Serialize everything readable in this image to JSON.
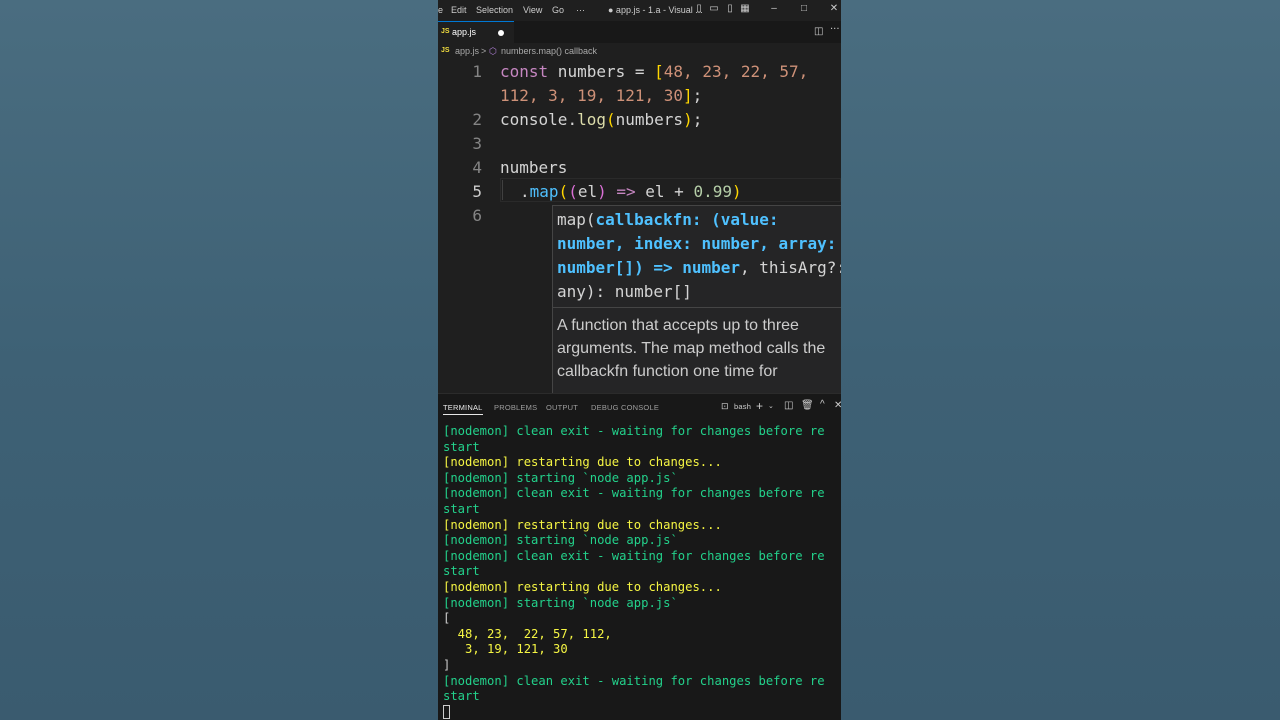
{
  "titlebar": {
    "menu": [
      "e",
      "Edit",
      "Selection",
      "View",
      "Go",
      "···"
    ],
    "title": "● app.js - 1.a - Visual ..."
  },
  "tab": {
    "icon": "JS",
    "name": "app.js",
    "dirty_icon": "dot-icon"
  },
  "breadcrumb": {
    "file": "app.js",
    "separator": ">",
    "symbol": "numbers.map() callback"
  },
  "editor": {
    "line_numbers": [
      "1",
      "2",
      "3",
      "4",
      "5",
      "6"
    ],
    "line1a": {
      "kw": "const",
      "name": " numbers ",
      "eq": "= ",
      "open": "[",
      "nums": "48, 23, 22, 57,",
      "nums_color": "#ce9178"
    },
    "line1b": {
      "nums": "112, 3, 19, 121, 30",
      "close": "]",
      "semi": ";"
    },
    "line2": {
      "obj": "console",
      "dot": ".",
      "fn": "log",
      "open": "(",
      "arg": "numbers",
      "close": ")",
      "semi": ";"
    },
    "line4": {
      "text": "numbers"
    },
    "line5": {
      "dot": ".",
      "fn": "map",
      "open1": "(",
      "open2": "(",
      "param": "el",
      "close2": ")",
      "arrow": " => ",
      "expr": "el + ",
      "num": "0.99",
      "close1": ")"
    }
  },
  "hover": {
    "sig_line1_a": "map(",
    "sig_line1_b": "callbackfn: (value:",
    "sig_line2": "number, index: number, array:",
    "sig_line3_a": "number[]) => number",
    "sig_line3_b": ", thisArg?:",
    "sig_line4": "any): number[]",
    "doc": "A function that accepts up to three arguments. The map method calls the callbackfn function one time for"
  },
  "panel": {
    "tabs": [
      "TERMINAL",
      "PROBLEMS",
      "OUTPUT",
      "DEBUG CONSOLE"
    ],
    "shell": "bash"
  },
  "terminal": {
    "lines": [
      {
        "t": "[nodemon] clean exit - waiting for changes before re",
        "c": "g"
      },
      {
        "t": "start",
        "c": "g"
      },
      {
        "t": "[nodemon] restarting due to changes...",
        "c": "y"
      },
      {
        "t": "[nodemon] starting `node app.js`",
        "c": "g"
      },
      {
        "t": "[nodemon] clean exit - waiting for changes before re",
        "c": "g"
      },
      {
        "t": "start",
        "c": "g"
      },
      {
        "t": "[nodemon] restarting due to changes...",
        "c": "y"
      },
      {
        "t": "[nodemon] starting `node app.js`",
        "c": "g"
      },
      {
        "t": "[nodemon] clean exit - waiting for changes before re",
        "c": "g"
      },
      {
        "t": "start",
        "c": "g"
      },
      {
        "t": "[nodemon] restarting due to changes...",
        "c": "y"
      },
      {
        "t": "[nodemon] starting `node app.js`",
        "c": "g"
      },
      {
        "t": "[",
        "c": "w"
      },
      {
        "t": "  48, 23,  22, 57, 112,",
        "c": "y"
      },
      {
        "t": "   3, 19, 121, 30",
        "c": "y"
      },
      {
        "t": "]",
        "c": "w"
      },
      {
        "t": "[nodemon] clean exit - waiting for changes before re",
        "c": "g"
      },
      {
        "t": "start",
        "c": "g"
      }
    ]
  }
}
